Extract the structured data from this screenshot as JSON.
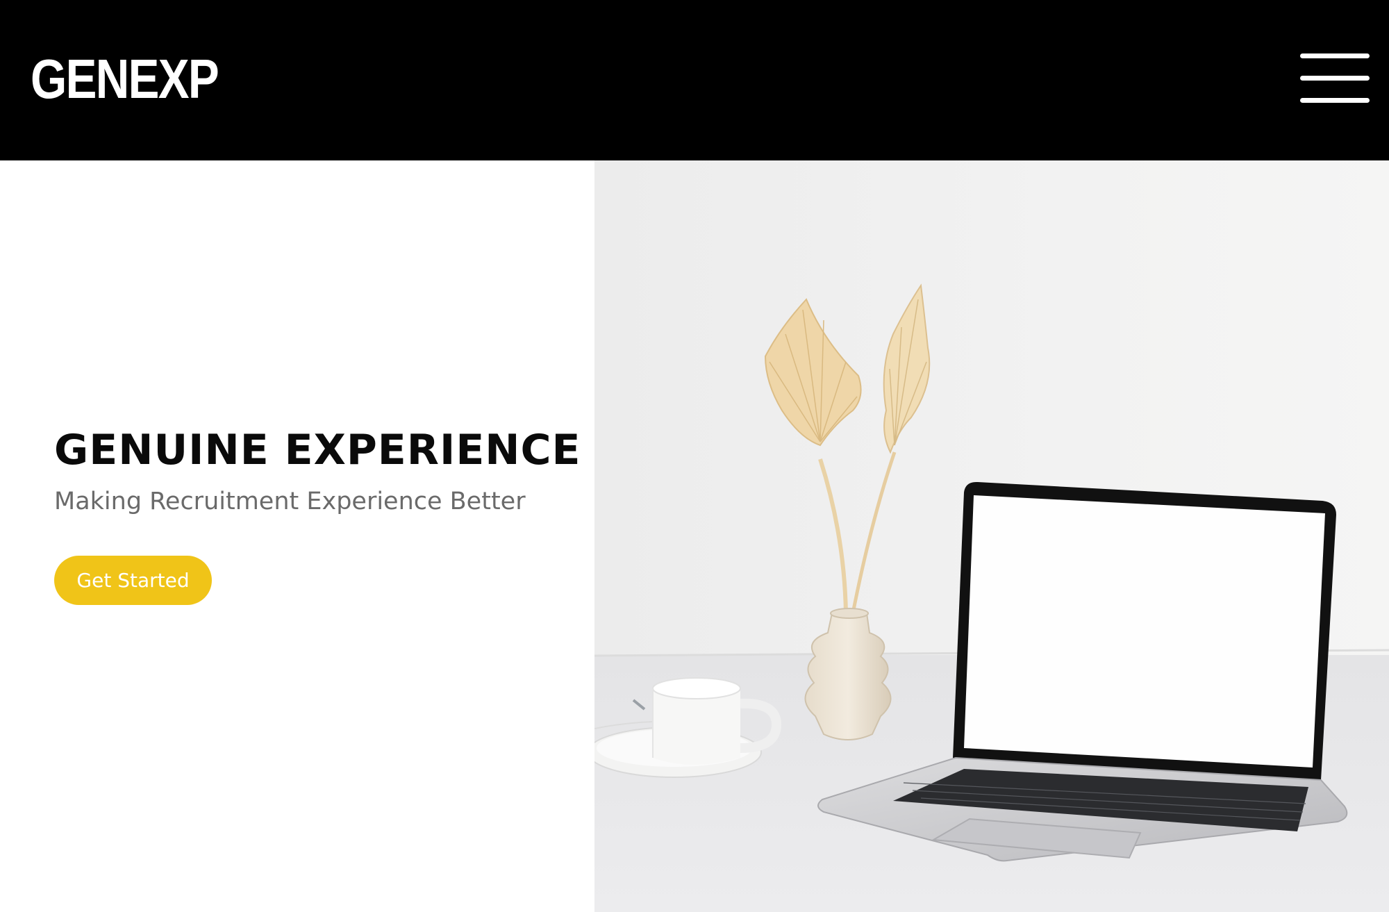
{
  "header": {
    "logo_text": "GENEXP",
    "menu_icon": "hamburger-menu-icon",
    "background": "#000000"
  },
  "hero": {
    "title": "GENUINE EXPERIENCE",
    "subtitle": "Making Recruitment Experience Better",
    "cta_label": "Get Started",
    "accent_color": "#f0c418"
  },
  "hero_image": {
    "subject": "workspace-photo-laptop-vase-mug"
  }
}
